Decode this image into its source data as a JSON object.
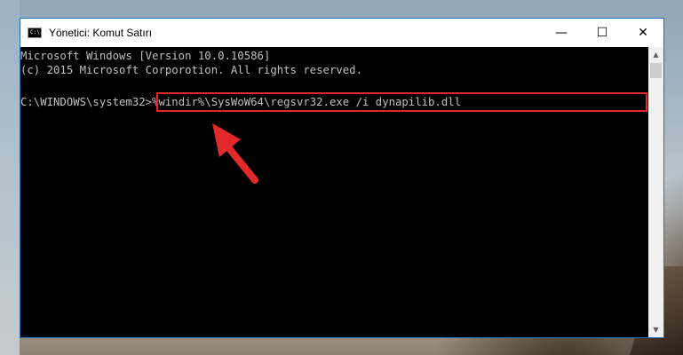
{
  "window": {
    "title": "Yönetici: Komut Satırı",
    "icon_text": "C:\\",
    "controls": {
      "minimize": "—",
      "maximize": "☐",
      "close": "✕"
    }
  },
  "console": {
    "lines": [
      "Microsoft Windows [Version 10.0.10586]",
      "(c) 2015 Microsoft Corporotion. All rights reserved.",
      ""
    ],
    "prompt": "C:\\WINDOWS\\system32>",
    "command": "%windir%\\SysWoW64\\regsvr32.exe /i dynapilib.dll"
  },
  "annotation": {
    "highlight_color": "#e2292b",
    "arrow_color": "#e2292b"
  },
  "icons": {
    "app": "cmd-icon",
    "scroll_up": "chevron-up-icon",
    "scroll_down": "chevron-down-icon"
  }
}
